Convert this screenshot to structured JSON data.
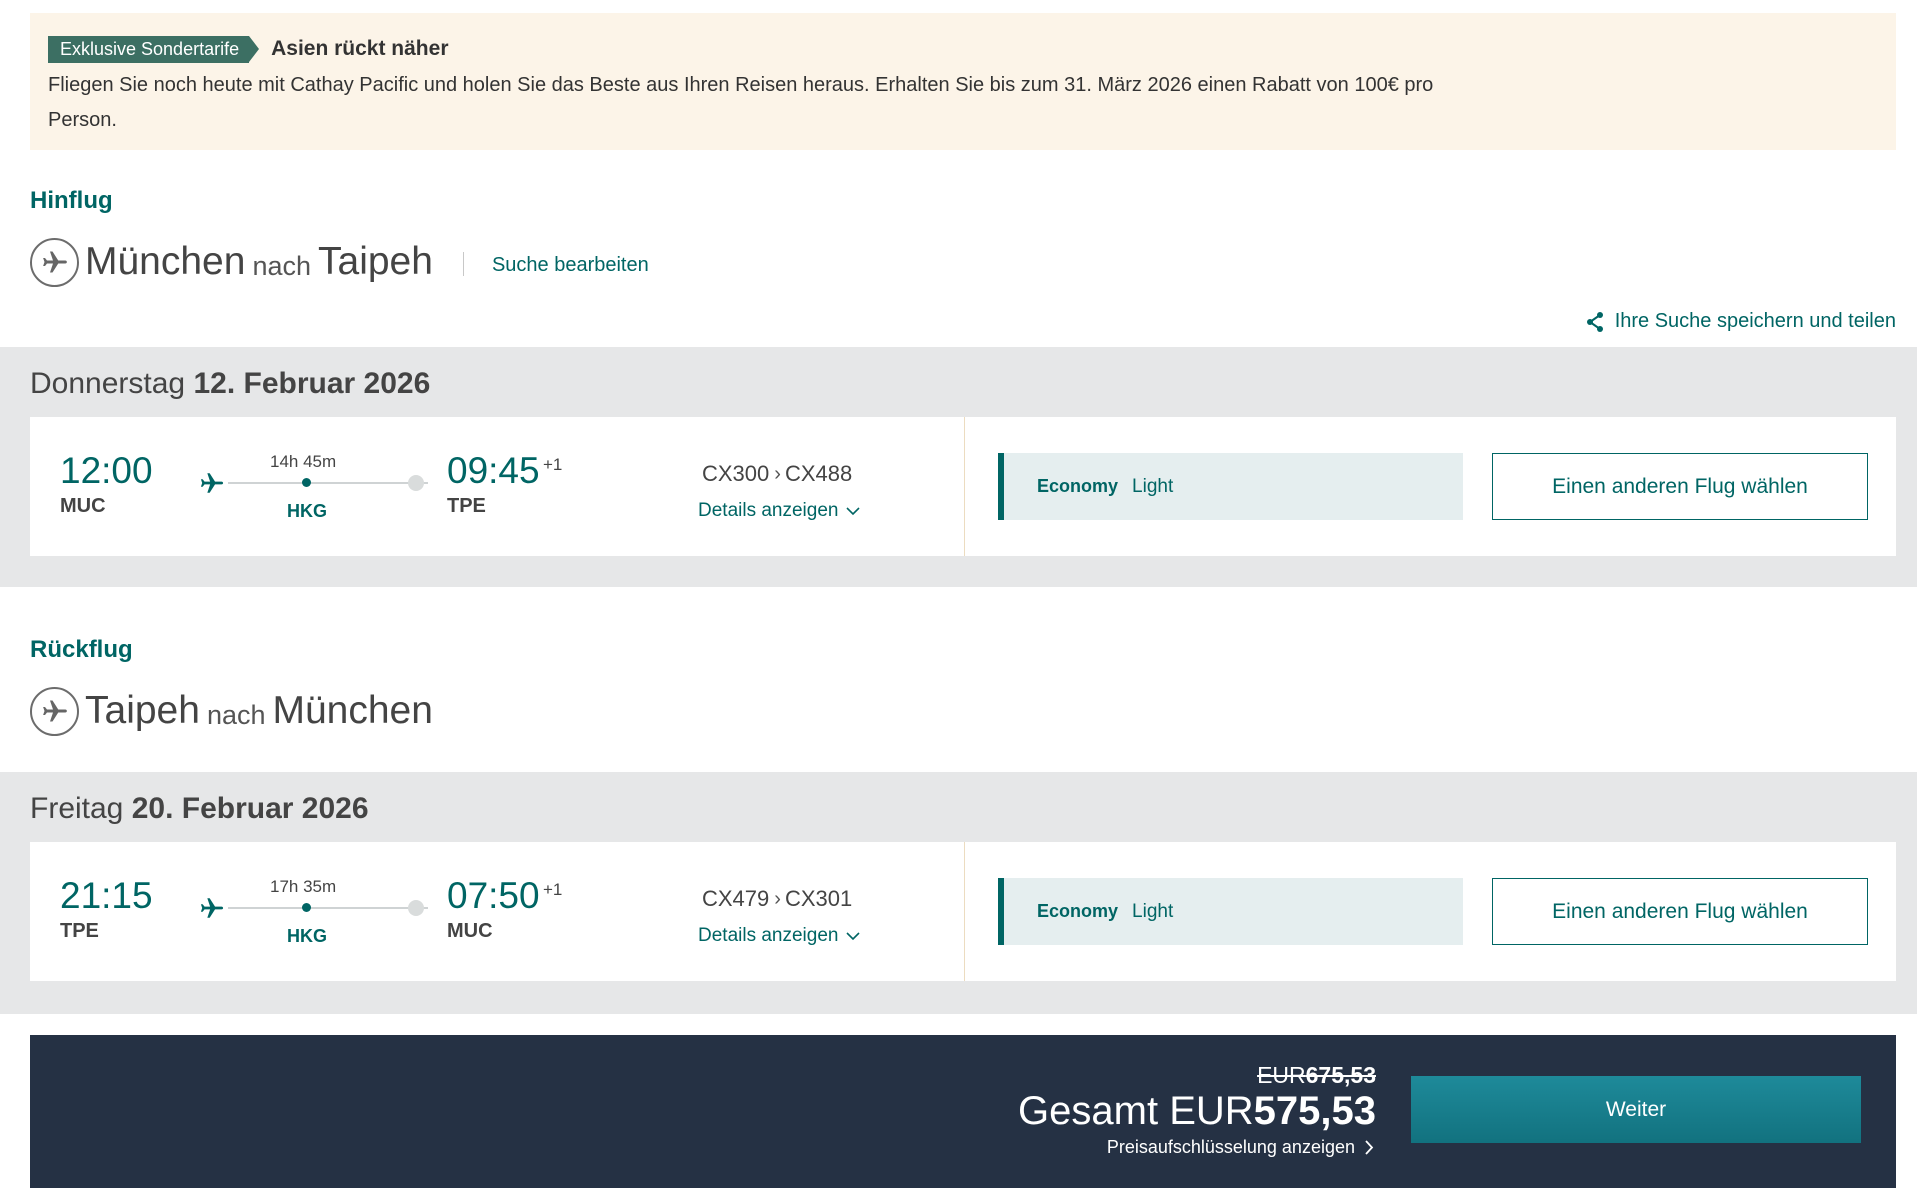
{
  "promo": {
    "tag": "Exklusive Sondertarife",
    "title": "Asien rückt näher",
    "text": "Fliegen Sie noch heute mit Cathay Pacific und holen Sie das Beste aus Ihren Reisen heraus. Erhalten Sie bis zum 31. März 2026 einen Rabatt von 100€ pro Person."
  },
  "outbound": {
    "label": "Hinflug",
    "from_city": "München",
    "connector": "nach",
    "to_city": "Taipeh",
    "edit_search": "Suche bearbeiten",
    "share": "Ihre Suche speichern und teilen",
    "day_name": "Donnerstag",
    "date": "12. Februar 2026",
    "dep_time": "12:00",
    "dep_code": "MUC",
    "duration": "14h 45m",
    "stop": "HKG",
    "arr_time": "09:45",
    "arr_plus": "+1",
    "arr_code": "TPE",
    "flight1": "CX300",
    "flight_sep": "›",
    "flight2": "CX488",
    "details": "Details anzeigen",
    "fare_class": "Economy",
    "fare_type": "Light",
    "other_flight": "Einen anderen Flug wählen"
  },
  "return": {
    "label": "Rückflug",
    "from_city": "Taipeh",
    "connector": "nach",
    "to_city": "München",
    "day_name": "Freitag",
    "date": "20. Februar 2026",
    "dep_time": "21:15",
    "dep_code": "TPE",
    "duration": "17h 35m",
    "stop": "HKG",
    "arr_time": "07:50",
    "arr_plus": "+1",
    "arr_code": "MUC",
    "flight1": "CX479",
    "flight_sep": "›",
    "flight2": "CX301",
    "details": "Details anzeigen",
    "fare_class": "Economy",
    "fare_type": "Light",
    "other_flight": "Einen anderen Flug wählen"
  },
  "footer": {
    "old_currency": "EUR",
    "old_amount": "675,53",
    "total_label": "Gesamt EUR",
    "total_amount": "575,53",
    "breakdown": "Preisaufschlüsselung anzeigen",
    "continue": "Weiter"
  },
  "colors": {
    "teal": "#006564",
    "promo_bg": "#fcf4e8",
    "tag_bg": "#3c6f63",
    "day_bg": "#e6e7e8",
    "fare_bg": "#e5eeef",
    "footer_bg": "#253144",
    "button": "#1e8a9a"
  },
  "icons": {
    "route": "airplane-icon",
    "share": "share-icon",
    "details": "chevron-down-icon",
    "breakdown": "chevron-right-icon"
  }
}
